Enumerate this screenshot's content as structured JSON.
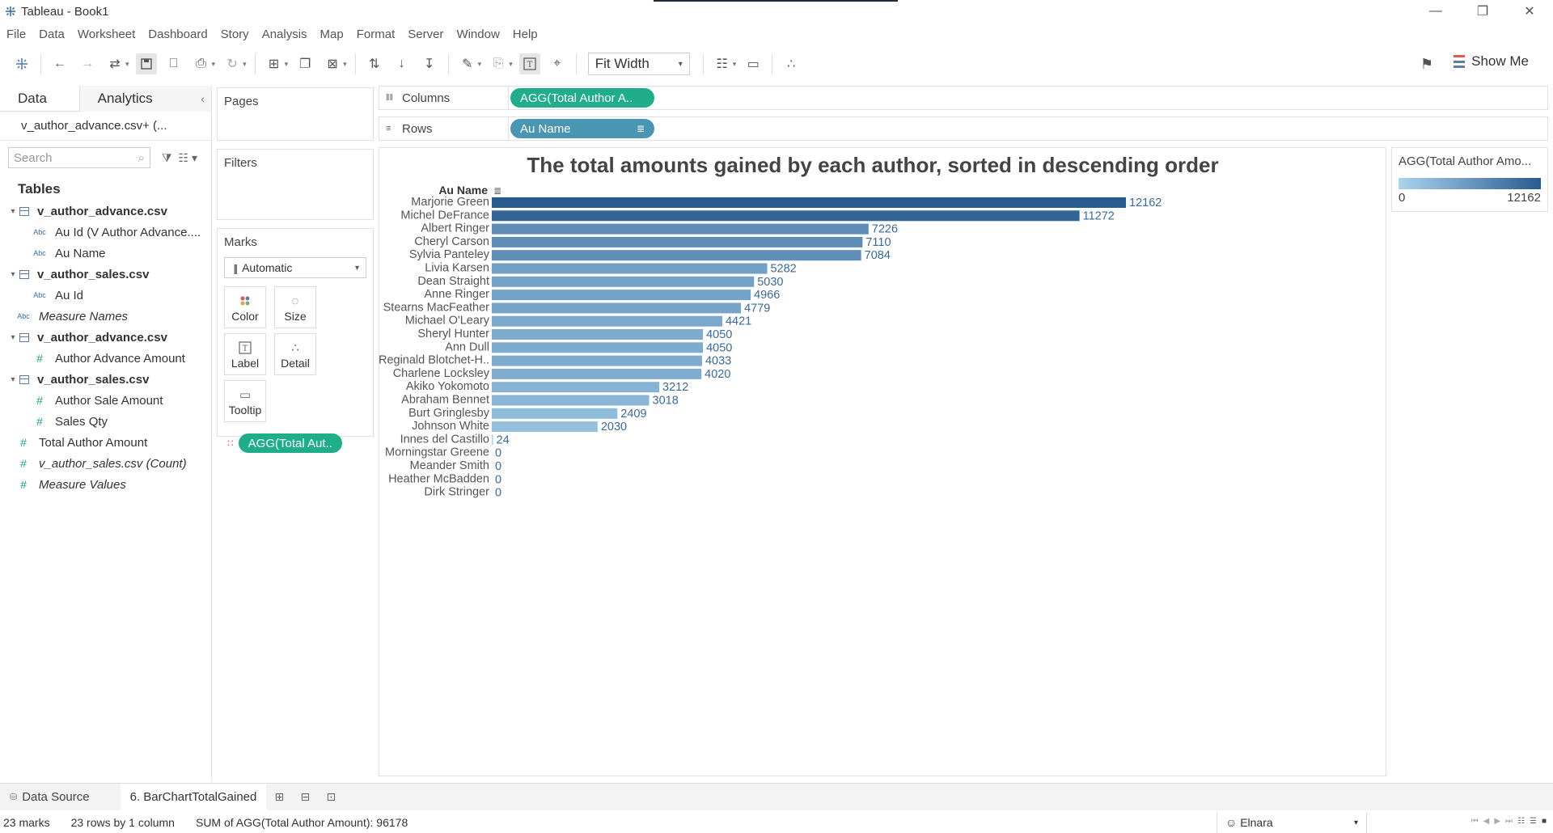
{
  "window": {
    "title": "Tableau - Book1",
    "minimize": "—",
    "restore": "❐",
    "close": "✕"
  },
  "menu": [
    "File",
    "Data",
    "Worksheet",
    "Dashboard",
    "Story",
    "Analysis",
    "Map",
    "Format",
    "Server",
    "Window",
    "Help"
  ],
  "toolbar": {
    "fit": "Fit Width",
    "show_me": "Show Me"
  },
  "data_pane": {
    "tab_data": "Data",
    "tab_analytics": "Analytics",
    "source": "v_author_advance.csv+ (...",
    "search_placeholder": "Search",
    "tables_heading": "Tables",
    "fields": [
      {
        "kind": "table",
        "label": "v_author_advance.csv"
      },
      {
        "kind": "dim",
        "label": "Au Id (V Author Advance...."
      },
      {
        "kind": "dim",
        "label": "Au Name"
      },
      {
        "kind": "table",
        "label": "v_author_sales.csv"
      },
      {
        "kind": "dim",
        "label": "Au Id"
      },
      {
        "kind": "dim-top",
        "label": "Measure Names"
      },
      {
        "kind": "table",
        "label": "v_author_advance.csv"
      },
      {
        "kind": "measure",
        "label": "Author Advance Amount"
      },
      {
        "kind": "table",
        "label": "v_author_sales.csv"
      },
      {
        "kind": "measure",
        "label": "Author Sale Amount"
      },
      {
        "kind": "measure",
        "label": "Sales Qty"
      },
      {
        "kind": "calc-top",
        "label": "Total Author Amount"
      },
      {
        "kind": "measure-top-italic",
        "label": "v_author_sales.csv (Count)"
      },
      {
        "kind": "measure-top-italic",
        "label": "Measure Values"
      }
    ],
    "type_abc": "Abc",
    "type_num": "#"
  },
  "cards": {
    "pages": "Pages",
    "filters": "Filters",
    "marks": "Marks",
    "mark_type": "Automatic",
    "mark_color": "Color",
    "mark_size": "Size",
    "mark_label": "Label",
    "mark_detail": "Detail",
    "mark_tooltip": "Tooltip",
    "mark_pill": "AGG(Total Aut.."
  },
  "shelves": {
    "columns_label": "Columns",
    "columns_pill": "AGG(Total Author A..",
    "rows_label": "Rows",
    "rows_pill": "Au Name"
  },
  "legend": {
    "title": "AGG(Total Author Amo...",
    "min": "0",
    "max": "12162",
    "color_low": "#a9d4ee",
    "color_high": "#2a5b8f"
  },
  "chart_data": {
    "type": "bar",
    "orientation": "horizontal",
    "title": "The total amounts gained by each author, sorted in descending order",
    "row_header": "Au Name",
    "categories": [
      "Marjorie Green",
      "Michel DeFrance",
      "Albert Ringer",
      "Cheryl Carson",
      "Sylvia Panteley",
      "Livia Karsen",
      "Dean Straight",
      "Anne Ringer",
      "Stearns MacFeather",
      "Michael O'Leary",
      "Sheryl Hunter",
      "Ann Dull",
      "Reginald Blotchet-H..",
      "Charlene Locksley",
      "Akiko Yokomoto",
      "Abraham Bennet",
      "Burt Gringlesby",
      "Johnson White",
      "Innes del Castillo",
      "Morningstar Greene",
      "Meander Smith",
      "Heather McBadden",
      "Dirk Stringer"
    ],
    "values": [
      12162,
      11272,
      7226,
      7110,
      7084,
      5282,
      5030,
      4966,
      4779,
      4421,
      4050,
      4050,
      4033,
      4020,
      3212,
      3018,
      2409,
      2030,
      24,
      0,
      0,
      0,
      0
    ],
    "value_labels": [
      "12162",
      "11272",
      "7226",
      "7110",
      "7084",
      "5282",
      "5030",
      "4966",
      "4779",
      "4421",
      "4050",
      "4050",
      "4033",
      "4020",
      "3212",
      "3018",
      "2409",
      "2030",
      "24",
      "0",
      "0",
      "0",
      "0"
    ],
    "xlim": [
      0,
      12162
    ],
    "legend": "right",
    "grid": false
  },
  "sheets": {
    "data_source": "Data Source",
    "active": "6. BarChartTotalGained"
  },
  "status": {
    "marks": "23 marks",
    "rows": "23 rows by 1 column",
    "sum": "SUM of AGG(Total Author Amount): 96178",
    "user": "Elnara"
  }
}
